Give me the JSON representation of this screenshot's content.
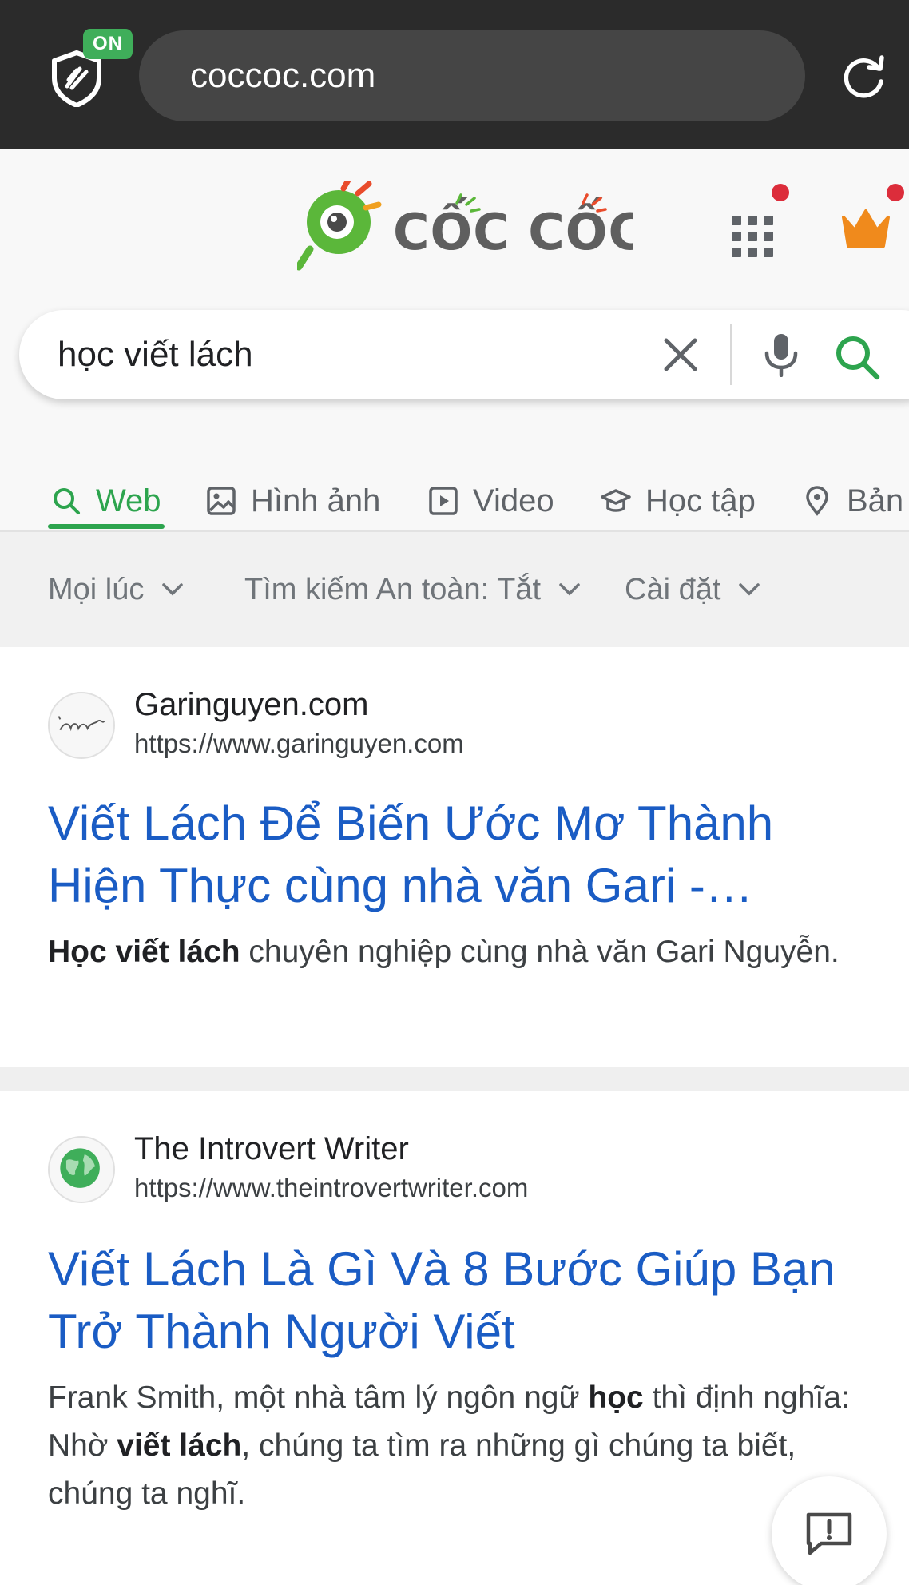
{
  "browser": {
    "shield_badge": "ON",
    "url": "coccoc.com"
  },
  "brand": {
    "logo_text": "CỐC CỐC",
    "accent_green": "#2da44e",
    "notification_red": "#dc2d3b",
    "crown_orange": "#f08a1c"
  },
  "search": {
    "query": "học viết lách"
  },
  "tabs": [
    {
      "label": "Web",
      "icon": "search-icon",
      "active": true
    },
    {
      "label": "Hình ảnh",
      "icon": "image-icon",
      "active": false
    },
    {
      "label": "Video",
      "icon": "video-icon",
      "active": false
    },
    {
      "label": "Học tập",
      "icon": "graduation-cap-icon",
      "active": false
    },
    {
      "label": "Bản",
      "icon": "map-pin-icon",
      "active": false
    }
  ],
  "filters": [
    {
      "label": "Mọi lúc"
    },
    {
      "label": "Tìm kiếm An toàn: Tắt"
    },
    {
      "label": "Cài đặt"
    }
  ],
  "results": [
    {
      "site_name": "Garinguyen.com",
      "url": "https://www.garinguyen.com",
      "title": "Viết Lách Để Biến Ước Mơ Thành Hiện Thực cùng nhà văn Gari -…",
      "snippet_bold_1": "Học viết lách",
      "snippet_text_1": " chuyên nghiệp cùng nhà văn Gari Nguyễn."
    },
    {
      "site_name": "The Introvert Writer",
      "url": "https://www.theintrovertwriter.com",
      "title": "Viết Lách Là Gì Và 8 Bước Giúp Bạn Trở Thành Người Viết",
      "snippet_text_1": "Frank Smith, một nhà tâm lý ngôn ngữ ",
      "snippet_bold_1": "học",
      "snippet_text_2": " thì định nghĩa: Nhờ ",
      "snippet_bold_2": "viết lách",
      "snippet_text_3": ", chúng ta tìm ra những gì chúng ta biết, chúng ta nghĩ."
    }
  ]
}
